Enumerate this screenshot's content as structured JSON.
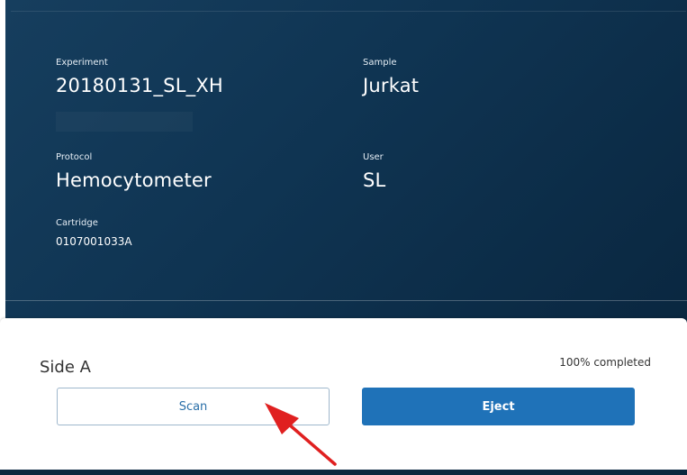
{
  "info": {
    "experiment": {
      "label": "Experiment",
      "value": "20180131_SL_XH"
    },
    "sample": {
      "label": "Sample",
      "value": "Jurkat"
    },
    "protocol": {
      "label": "Protocol",
      "value": "Hemocytometer"
    },
    "user": {
      "label": "User",
      "value": "SL"
    },
    "cartridge": {
      "label": "Cartridge",
      "value": "0107001033A"
    }
  },
  "action": {
    "side_title": "Side A",
    "progress_text": "100% completed",
    "scan_label": "Scan",
    "eject_label": "Eject"
  },
  "colors": {
    "panel_bg": "#0f3452",
    "primary_button": "#1f72b8",
    "annotation_arrow": "#e02020"
  },
  "icons": {
    "annotation": "red-arrow-icon"
  }
}
